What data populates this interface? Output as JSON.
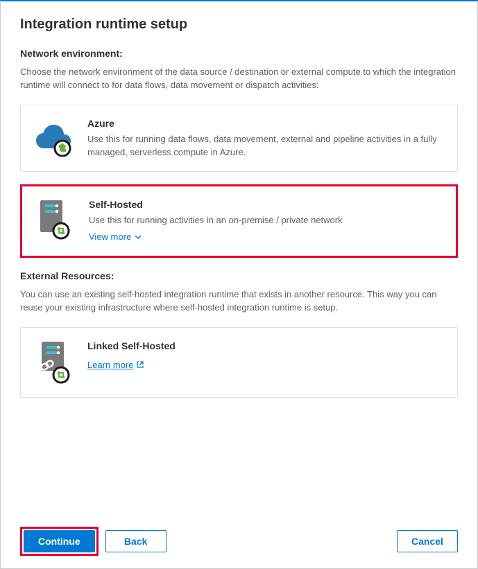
{
  "title": "Integration runtime setup",
  "section1": {
    "heading": "Network environment:",
    "description": "Choose the network environment of the data source / destination or external compute to which the integration runtime will connect to for data flows, data movement or dispatch activities:"
  },
  "options": [
    {
      "title": "Azure",
      "description": "Use this for running data flows, data movement, external and pipeline activities in a fully managed, serverless compute in Azure."
    },
    {
      "title": "Self-Hosted",
      "description": "Use this for running activities in an on-premise / private network",
      "viewMore": "View more"
    }
  ],
  "section2": {
    "heading": "External Resources:",
    "description": "You can use an existing self-hosted integration runtime that exists in another resource. This way you can reuse your existing infrastructure where self-hosted integration runtime is setup."
  },
  "linked": {
    "title": "Linked Self-Hosted",
    "learnMore": "Learn more"
  },
  "buttons": {
    "continue": "Continue",
    "back": "Back",
    "cancel": "Cancel"
  }
}
